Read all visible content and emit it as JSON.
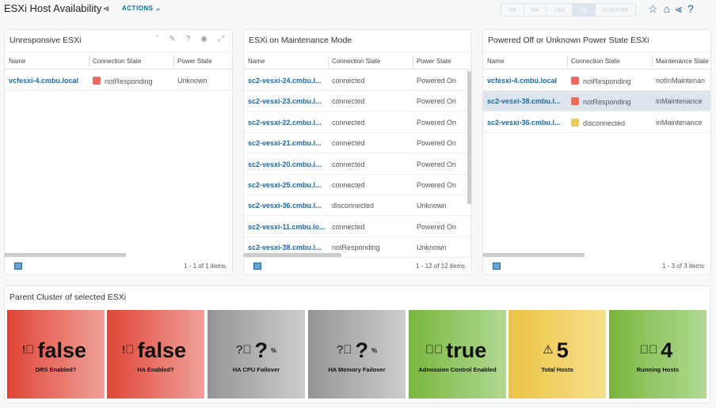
{
  "header": {
    "title": "ESXi Host Availability",
    "actions_label": "ACTIONS",
    "time_ranges": [
      "1H",
      "6H",
      "24H",
      "7D",
      "CUSTOM"
    ],
    "selected_time_range": "7D"
  },
  "panels": [
    {
      "title": "Unresponsive ESXi",
      "columns": [
        "Name",
        "Connection State",
        "Power State"
      ],
      "rows": [
        [
          "vcfesxi-4.cmbu.local",
          "notResponding",
          "Unknown"
        ]
      ],
      "footer": "1 - 1 of 1 items"
    },
    {
      "title": "ESXi on Maintenance Mode",
      "columns": [
        "Name",
        "Connection State",
        "Power State"
      ],
      "rows": [
        [
          "sc2-vesxi-24.cmbu.l...",
          "connected",
          "Powered On"
        ],
        [
          "sc2-vesxi-23.cmbu.l...",
          "connected",
          "Powered On"
        ],
        [
          "sc2-vesxi-22.cmbu.l...",
          "connected",
          "Powered On"
        ],
        [
          "sc2-vesxi-21.cmbu.l...",
          "connected",
          "Powered On"
        ],
        [
          "sc2-vesxi-20.cmbu.l...",
          "connected",
          "Powered On"
        ],
        [
          "sc2-vesxi-25.cmbu.l...",
          "connected",
          "Powered On"
        ],
        [
          "sc2-vesxi-36.cmbu.l...",
          "disconnected",
          "Unknown"
        ],
        [
          "sc2-vesxi-11.cmbu.lo...",
          "connected",
          "Powered On"
        ],
        [
          "sc2-vesxi-38.cmbu.l...",
          "notResponding",
          "Unknown"
        ]
      ],
      "footer": "1 - 12 of 12 items"
    },
    {
      "title": "Powered Off or Unknown Power State ESXi",
      "columns": [
        "Name",
        "Connection State",
        "Maintenance State"
      ],
      "rows": [
        [
          "vcfesxi-4.cmbu.local",
          "notResponding",
          "notInMaintenan"
        ],
        [
          "sc2-vesxi-38.cmbu.l...",
          "notResponding",
          "inMaintenance"
        ],
        [
          "sc2-vesxi-36.cmbu.l...",
          "disconnected",
          "inMaintenance"
        ]
      ],
      "selected_row": 1,
      "footer": "1 - 3 of 3 items"
    }
  ],
  "status_colors": {
    "notResponding": "#ec6a5e",
    "disconnected": "#e8cc5a"
  },
  "cluster": {
    "title": "Parent Cluster of selected ESXi",
    "tiles": [
      {
        "value": "false",
        "unit": "",
        "label": "DRS Enabled?",
        "icon": "alert-circle-icon",
        "color": "red"
      },
      {
        "value": "false",
        "unit": "",
        "label": "HA Enabled?",
        "icon": "alert-circle-icon",
        "color": "red"
      },
      {
        "value": "?",
        "unit": "%",
        "label": "HA CPU Failover",
        "icon": "question-circle-icon",
        "color": "gray"
      },
      {
        "value": "?",
        "unit": "%",
        "label": "HA Memory Failover",
        "icon": "question-circle-icon",
        "color": "gray"
      },
      {
        "value": "true",
        "unit": "",
        "label": "Admission Control Enabled",
        "icon": "check-circle-icon",
        "color": "green"
      },
      {
        "value": "5",
        "unit": "",
        "label": "Total Hosts",
        "icon": "warning-triangle-icon",
        "color": "yellow"
      },
      {
        "value": "4",
        "unit": "",
        "label": "Running Hosts",
        "icon": "check-circle-icon",
        "color": "green"
      }
    ]
  }
}
